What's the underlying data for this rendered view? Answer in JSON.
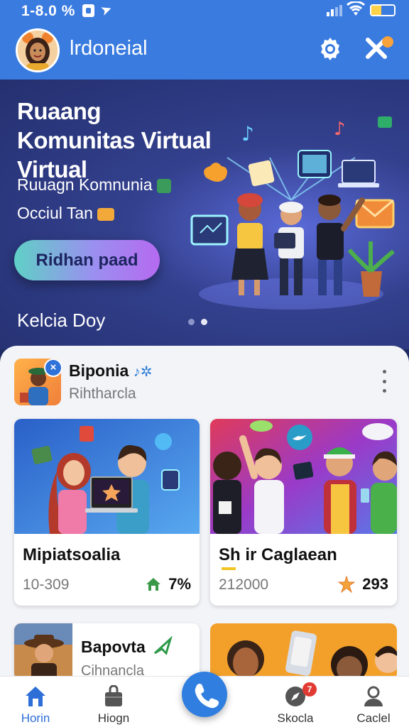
{
  "status": {
    "time": "1-8.0 %"
  },
  "header": {
    "title": "lrdoneial"
  },
  "hero": {
    "title": "Ruaang Komunitas Virtual Virtual",
    "subtitle_line1": "Ruuagn Komnunia",
    "subtitle_line2": "Occiul Tan",
    "cta": "Ridhan paad",
    "caption": "Kelcia Doy"
  },
  "feed": {
    "name": "Biponia",
    "subtitle": "Rihtharcla",
    "badge_icon": "close-icon"
  },
  "cards": [
    {
      "title": "Mipiatsoalia",
      "left_stat": "10-309",
      "right_stat": "7%",
      "right_icon": "home-icon"
    },
    {
      "title": "Sh ir Caglaean",
      "left_stat": "212000",
      "right_stat": "293",
      "right_icon": "star-icon"
    },
    {
      "title": "Bapovta",
      "subtitle": "Cihnancla"
    }
  ],
  "bottom_nav": {
    "items": [
      {
        "label": "Horin",
        "icon": "home-icon",
        "active": true
      },
      {
        "label": "Hiogn",
        "icon": "bag-icon"
      },
      {
        "label": "Skocla",
        "icon": "compass-icon",
        "badge": "7"
      },
      {
        "label": "Caclel",
        "icon": "profile-icon"
      }
    ],
    "center_icon": "phone-icon"
  },
  "colors": {
    "accent": "#3a7be0",
    "hero_bg": "#2a3678",
    "badge": "#e03a32"
  }
}
